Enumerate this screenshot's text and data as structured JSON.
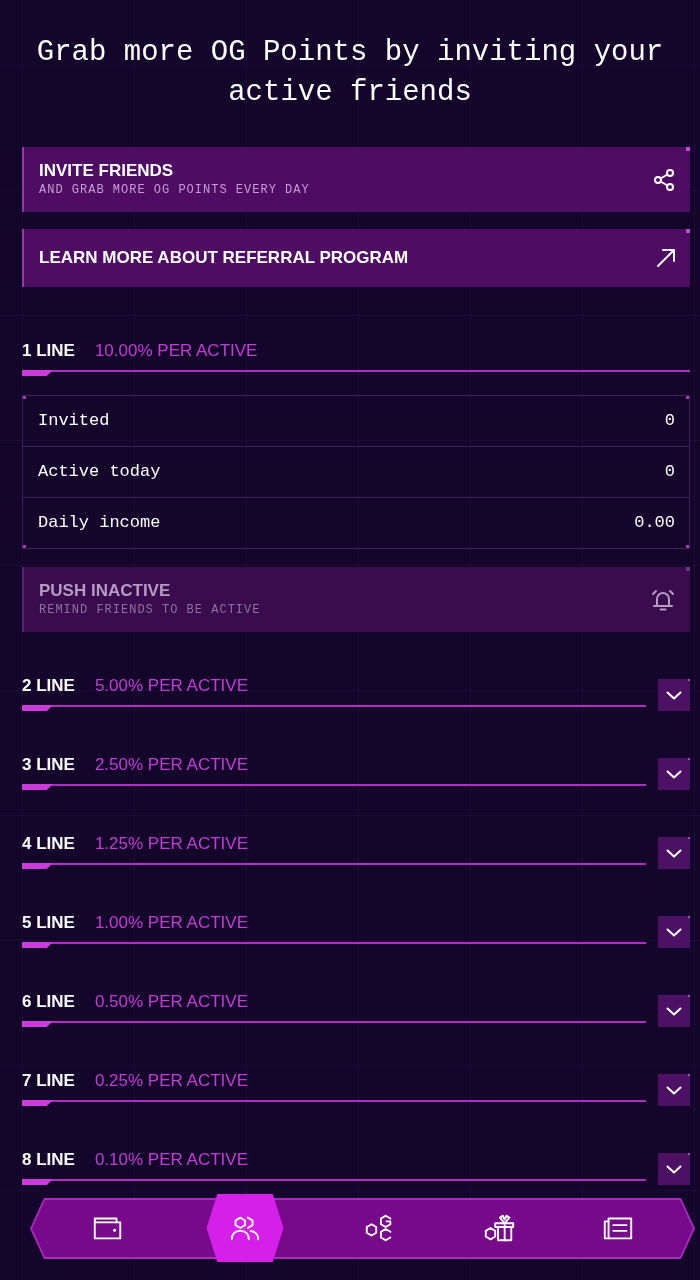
{
  "title": "Grab more OG Points by inviting your active friends",
  "actions": [
    {
      "kind": "share",
      "title": "INVITE FRIENDS",
      "subtitle": "AND GRAB MORE OG POINTS EVERY DAY"
    },
    {
      "kind": "link",
      "title": "LEARN MORE ABOUT REFERRAL PROGRAM"
    }
  ],
  "lines": [
    {
      "label": "1 LINE",
      "rate": "10.00% PER ACTIVE",
      "expanded": true,
      "stats": [
        {
          "label": "Invited",
          "value": "0"
        },
        {
          "label": "Active today",
          "value": "0"
        },
        {
          "label": "Daily income",
          "value": "0.00"
        }
      ],
      "push": {
        "kind": "notify",
        "title": "PUSH INACTIVE",
        "subtitle": "REMIND FRIENDS TO BE ACTIVE",
        "disabled": true
      }
    },
    {
      "label": "2 LINE",
      "rate": "5.00% PER ACTIVE",
      "expanded": false
    },
    {
      "label": "3 LINE",
      "rate": "2.50% PER ACTIVE",
      "expanded": false
    },
    {
      "label": "4 LINE",
      "rate": "1.25% PER ACTIVE",
      "expanded": false
    },
    {
      "label": "5 LINE",
      "rate": "1.00% PER ACTIVE",
      "expanded": false
    },
    {
      "label": "6 LINE",
      "rate": "0.50% PER ACTIVE",
      "expanded": false
    },
    {
      "label": "7 LINE",
      "rate": "0.25% PER ACTIVE",
      "expanded": false
    },
    {
      "label": "8 LINE",
      "rate": "0.10% PER ACTIVE",
      "expanded": false
    }
  ],
  "nav": [
    {
      "kind": "wallet",
      "selected": false
    },
    {
      "kind": "friends",
      "selected": true
    },
    {
      "kind": "og",
      "selected": false
    },
    {
      "kind": "gifts",
      "selected": false
    },
    {
      "kind": "news",
      "selected": false
    }
  ]
}
